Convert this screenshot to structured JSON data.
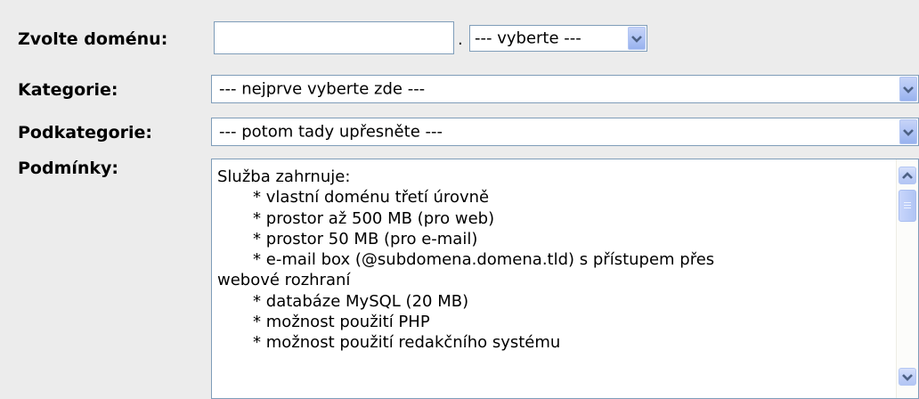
{
  "form": {
    "domain_label": "Zvolte doménu:",
    "domain_input_value": "",
    "domain_separator": ".",
    "tld_select_value": "--- vyberte ---",
    "category_label": "Kategorie:",
    "category_select_value": "--- nejprve vyberte zde ---",
    "subcategory_label": "Podkategorie:",
    "subcategory_select_value": "--- potom tady upřesněte ---",
    "conditions_label": "Podmínky:",
    "conditions_text": "Služba zahrnuje:\n       * vlastní doménu třetí úrovně\n       * prostor až 500 MB (pro web)\n       * prostor 50 MB (pro e-mail)\n       * e-mail box (@subdomena.domena.tld) s přístupem přes\nwebové rozhraní\n       * databáze MySQL (20 MB)\n       * možnost použití PHP\n       * možnost použití redakčního systému"
  },
  "icons": {
    "dropdown": "chevron-down-icon",
    "scroll_up": "chevron-up-icon",
    "scroll_down": "chevron-down-icon"
  },
  "colors": {
    "background": "#ececec",
    "border": "#7f9db9",
    "button": "#b0c4f5",
    "arrow": "#4d6185"
  }
}
